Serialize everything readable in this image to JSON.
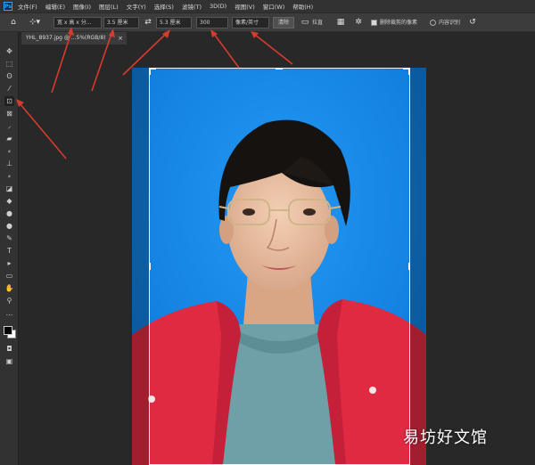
{
  "app": {
    "logo_text": "Ps"
  },
  "menu": [
    "文件(F)",
    "编辑(E)",
    "图像(I)",
    "图层(L)",
    "文字(Y)",
    "选择(S)",
    "滤镜(T)",
    "3D(D)",
    "视图(V)",
    "窗口(W)",
    "帮助(H)"
  ],
  "options": {
    "ratio_preset": "宽 x 高 x 分...",
    "width_value": "3.5 厘米",
    "height_value": "5.3 厘米",
    "resolution_value": "300",
    "resolution_unit": "像素/英寸",
    "clear_label": "清除",
    "straighten_label": "拉直",
    "delete_cropped_label": "删除裁剪的像素",
    "content_aware_label": "内容识别"
  },
  "document": {
    "tab_title": "YHL_8937.jpg @ ...5%(RGB/8)",
    "close_glyph": "×"
  },
  "watermark": "易坊好文馆",
  "colors": {
    "photo_background": "#1487ea",
    "jacket": "#e02a42",
    "sweater": "#6fa0a8",
    "annotation_arrow": "#d63b2f"
  }
}
